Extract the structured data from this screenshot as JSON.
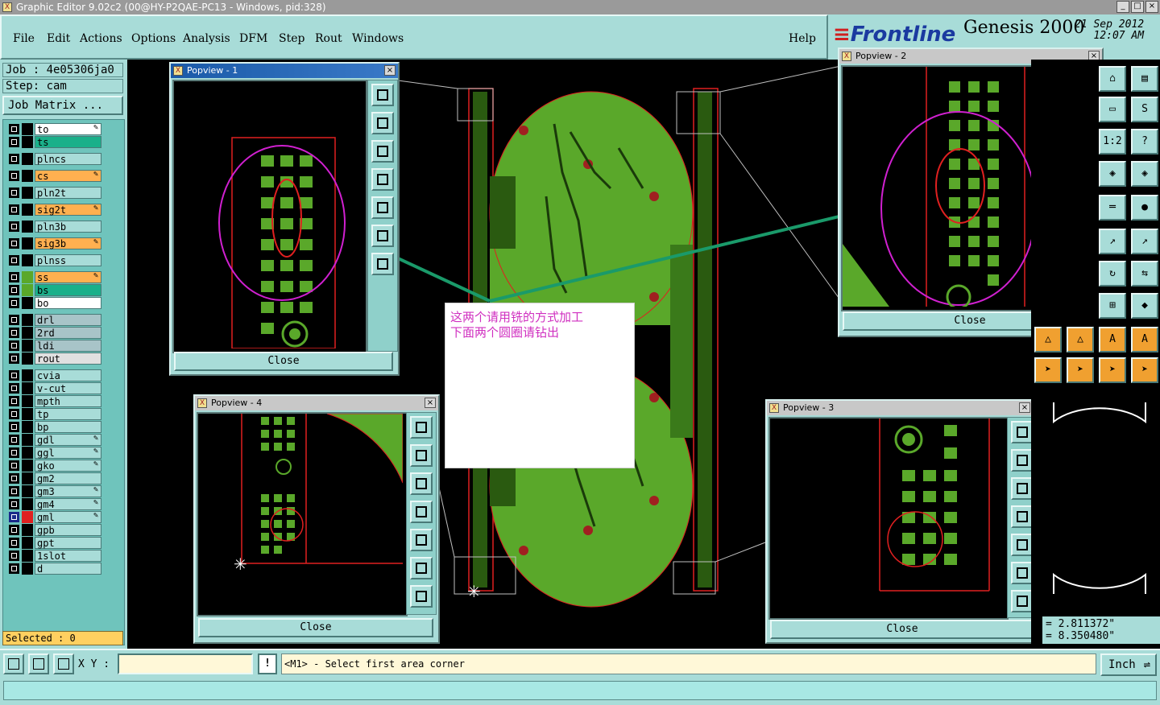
{
  "window": {
    "title": "Graphic Editor 9.02c2 (00@HY-P2QAE-PC13 - Windows, pid:328)"
  },
  "menu": {
    "items": [
      "File",
      "Edit",
      "Actions",
      "Options",
      "Analysis",
      "DFM",
      "Step",
      "Rout",
      "Windows"
    ],
    "help": "Help"
  },
  "brand": {
    "logo": "Frontline",
    "product": "Genesis 2000",
    "date": "21 Sep 2012",
    "time": "12:07 AM"
  },
  "job": {
    "job": "Job : 4e05306ja0",
    "step": "Step: cam",
    "matrix_button": "Job Matrix ..."
  },
  "layers": [
    {
      "name": "to",
      "color": "#ffffff",
      "edit": true
    },
    {
      "name": "ts",
      "color": "#1ab08a",
      "edit": false
    },
    {
      "name": "plncs",
      "color": "#a8dcd8",
      "edit": false
    },
    {
      "name": "cs",
      "color": "#ffb050",
      "edit": true
    },
    {
      "name": "pln2t",
      "color": "#a8dcd8",
      "edit": false
    },
    {
      "name": "sig2t",
      "color": "#ffb050",
      "edit": true
    },
    {
      "name": "pln3b",
      "color": "#a8dcd8",
      "edit": false
    },
    {
      "name": "sig3b",
      "color": "#ffb050",
      "edit": true
    },
    {
      "name": "plnss",
      "color": "#a8dcd8",
      "edit": false
    },
    {
      "name": "ss",
      "color": "#ffb050",
      "edit": true
    },
    {
      "name": "bs",
      "color": "#1ab08a",
      "edit": false
    },
    {
      "name": "bo",
      "color": "#ffffff",
      "edit": false
    },
    {
      "name": "drl",
      "color": "#a8c4c8",
      "edit": false
    },
    {
      "name": "2rd",
      "color": "#a8c4c8",
      "edit": false
    },
    {
      "name": "ldi",
      "color": "#a8c4c8",
      "edit": false
    },
    {
      "name": "rout",
      "color": "#e0e0e0",
      "edit": false
    },
    {
      "name": "cvia",
      "color": "#a8dcd8",
      "edit": false
    },
    {
      "name": "v-cut",
      "color": "#a8dcd8",
      "edit": false
    },
    {
      "name": "mpth",
      "color": "#a8dcd8",
      "edit": false
    },
    {
      "name": "tp",
      "color": "#a8dcd8",
      "edit": false
    },
    {
      "name": "bp",
      "color": "#a8dcd8",
      "edit": false
    },
    {
      "name": "gdl",
      "color": "#a8dcd8",
      "edit": true
    },
    {
      "name": "ggl",
      "color": "#a8dcd8",
      "edit": true
    },
    {
      "name": "gko",
      "color": "#a8dcd8",
      "edit": true
    },
    {
      "name": "gm2",
      "color": "#a8dcd8",
      "edit": false
    },
    {
      "name": "gm3",
      "color": "#a8dcd8",
      "edit": true
    },
    {
      "name": "gm4",
      "color": "#a8dcd8",
      "edit": true
    },
    {
      "name": "gml",
      "color": "#a8dcd8",
      "edit": true
    },
    {
      "name": "gpb",
      "color": "#a8dcd8",
      "edit": false
    },
    {
      "name": "gpt",
      "color": "#a8dcd8",
      "edit": false
    },
    {
      "name": "1slot",
      "color": "#a8dcd8",
      "edit": false
    },
    {
      "name": "d",
      "color": "#a8dcd8",
      "edit": false
    }
  ],
  "selected": "Selected : 0",
  "popviews": [
    {
      "title": "Popview - 1",
      "close": "Close"
    },
    {
      "title": "Popview - 2",
      "close": "Close"
    },
    {
      "title": "Popview - 3",
      "close": "Close"
    },
    {
      "title": "Popview - 4",
      "close": "Close"
    }
  ],
  "note": {
    "line1": "这两个请用铣的方式加工",
    "line2": "下面两个圆圈请钻出"
  },
  "coords": {
    "x": "= 2.811372\"",
    "y": "= 8.350480\""
  },
  "status": {
    "xy_label": "X Y :",
    "xy_value": "",
    "excl": "!",
    "message": "<M1> - Select first area corner",
    "unit": "Inch"
  },
  "colors": {
    "panel": "#a8dcd8",
    "board": "#5aa82a",
    "outline": "#e02020",
    "ellipse": "#d020d0"
  }
}
